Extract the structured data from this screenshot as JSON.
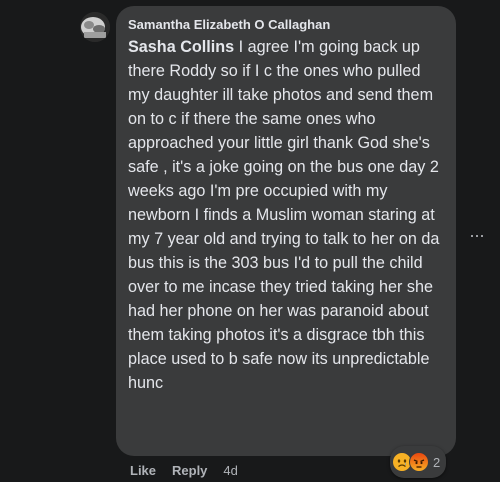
{
  "comment": {
    "author": "Samantha Elizabeth O Callaghan",
    "mention": "Sasha Collins",
    "text": " I agree I'm going back up there Roddy so if I c the ones who pulled my daughter ill take photos and send them on to c if there the same ones who approached your little girl thank God she's safe , it's a joke going on the bus one day 2 weeks ago I'm pre occupied with my newborn I finds a Muslim woman staring at my 7 year old and trying to talk to her on da bus this is the 303 bus I'd to pull the child over to me incase they tried taking her she had her phone on her was paranoid about them taking photos it's a disgrace tbh this place used to b safe now its unpredictable hunc",
    "more_icon": "more-horizontal-icon",
    "more_label": "..."
  },
  "actions": {
    "like_label": "Like",
    "reply_label": "Reply",
    "timestamp": "4d"
  },
  "reactions": {
    "icons": [
      "sad-reaction-icon",
      "angry-reaction-icon"
    ],
    "count": "2"
  },
  "colors": {
    "background": "#18191a",
    "bubble": "#3a3b3c",
    "primary_text": "#e4e6eb",
    "secondary_text": "#b0b3b8"
  }
}
